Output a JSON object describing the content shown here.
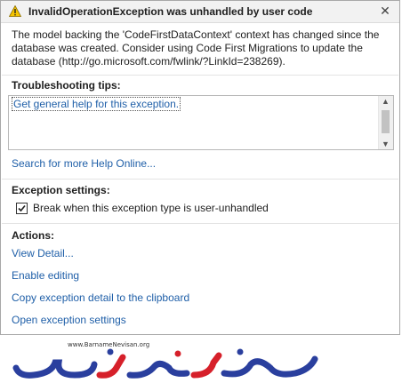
{
  "dialog": {
    "title": "InvalidOperationException was unhandled by user code",
    "close_glyph": "✕",
    "message": "The model backing the 'CodeFirstDataContext' context has changed since the database was created. Consider using Code First Migrations to update the database (http://go.microsoft.com/fwlink/?LinkId=238269).",
    "troubleshooting": {
      "label": "Troubleshooting tips:",
      "tips": [
        "Get general help for this exception."
      ]
    },
    "search_link": "Search for more Help Online...",
    "exception_settings": {
      "label": "Exception settings:",
      "checkbox_label": "Break when this exception type is user-unhandled",
      "checked": true
    },
    "actions": {
      "label": "Actions:",
      "items": [
        "View Detail...",
        "Enable editing",
        "Copy exception detail to the clipboard",
        "Open exception settings"
      ]
    }
  },
  "watermark": {
    "url": "www.BarnameNevisan.org"
  },
  "colors": {
    "link": "#1f5fa8",
    "warning": "#f5c400",
    "logo_blue": "#2a3f9e",
    "logo_red": "#d6202a"
  }
}
